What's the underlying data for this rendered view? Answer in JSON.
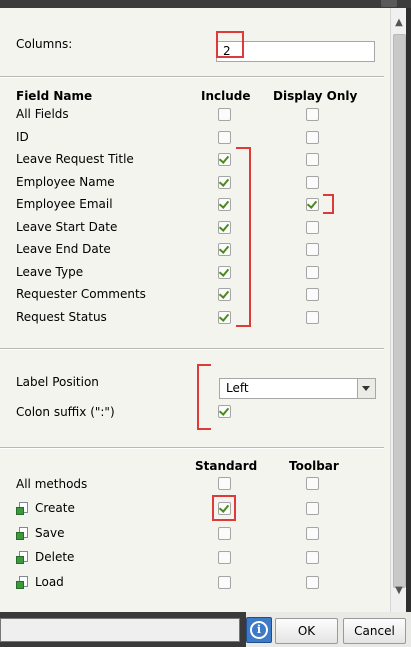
{
  "columns": {
    "label": "Columns:",
    "value": "2"
  },
  "fields": {
    "headers": {
      "name": "Field Name",
      "include": "Include",
      "display_only": "Display Only"
    },
    "rows": [
      {
        "name": "All Fields",
        "include": false,
        "display_only": false
      },
      {
        "name": "ID",
        "include": false,
        "display_only": false
      },
      {
        "name": "Leave Request Title",
        "include": true,
        "display_only": false
      },
      {
        "name": "Employee Name",
        "include": true,
        "display_only": false
      },
      {
        "name": "Employee Email",
        "include": true,
        "display_only": true
      },
      {
        "name": "Leave Start Date",
        "include": true,
        "display_only": false
      },
      {
        "name": "Leave End Date",
        "include": true,
        "display_only": false
      },
      {
        "name": "Leave Type",
        "include": true,
        "display_only": false
      },
      {
        "name": "Requester Comments",
        "include": true,
        "display_only": false
      },
      {
        "name": "Request Status",
        "include": true,
        "display_only": false
      }
    ]
  },
  "label_position": {
    "label": "Label Position",
    "value": "Left"
  },
  "colon_suffix": {
    "label": "Colon suffix (\":\")",
    "checked": true
  },
  "methods": {
    "headers": {
      "standard": "Standard",
      "toolbar": "Toolbar"
    },
    "all_label": "All methods",
    "all": {
      "standard": false,
      "toolbar": false
    },
    "rows": [
      {
        "name": "Create",
        "standard": true,
        "toolbar": false
      },
      {
        "name": "Save",
        "standard": false,
        "toolbar": false
      },
      {
        "name": "Delete",
        "standard": false,
        "toolbar": false
      },
      {
        "name": "Load",
        "standard": false,
        "toolbar": false
      }
    ]
  },
  "footer": {
    "ok": "OK",
    "cancel": "Cancel",
    "info_icon": "i"
  },
  "colors": {
    "highlight": "#dd3a3a",
    "check": "#4b8a1c",
    "info_button": "#3d7ac8"
  }
}
